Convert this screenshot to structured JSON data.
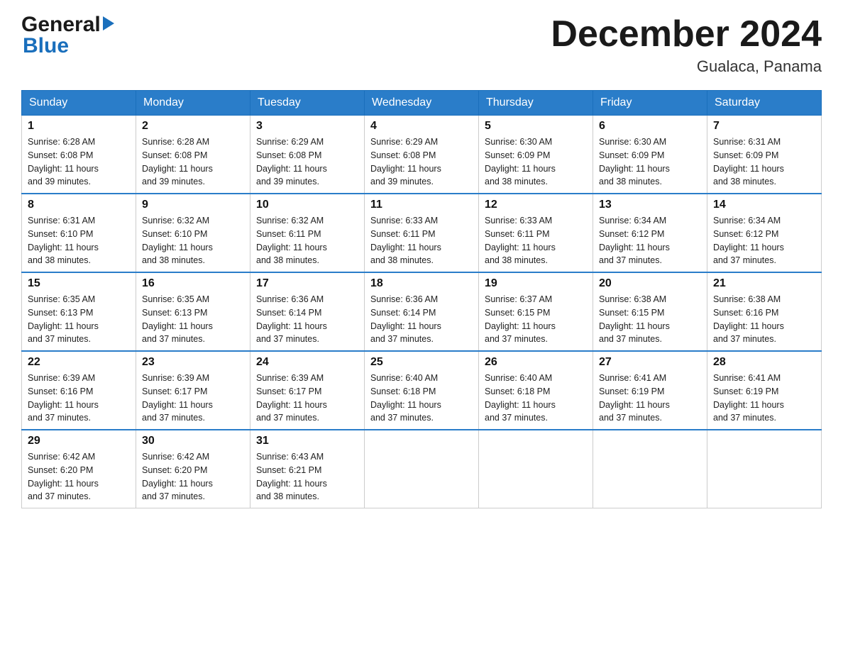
{
  "header": {
    "logo_general": "General",
    "logo_blue": "Blue",
    "month_title": "December 2024",
    "location": "Gualaca, Panama"
  },
  "weekdays": [
    "Sunday",
    "Monday",
    "Tuesday",
    "Wednesday",
    "Thursday",
    "Friday",
    "Saturday"
  ],
  "weeks": [
    [
      {
        "day": "1",
        "sunrise": "6:28 AM",
        "sunset": "6:08 PM",
        "daylight": "11 hours and 39 minutes."
      },
      {
        "day": "2",
        "sunrise": "6:28 AM",
        "sunset": "6:08 PM",
        "daylight": "11 hours and 39 minutes."
      },
      {
        "day": "3",
        "sunrise": "6:29 AM",
        "sunset": "6:08 PM",
        "daylight": "11 hours and 39 minutes."
      },
      {
        "day": "4",
        "sunrise": "6:29 AM",
        "sunset": "6:08 PM",
        "daylight": "11 hours and 39 minutes."
      },
      {
        "day": "5",
        "sunrise": "6:30 AM",
        "sunset": "6:09 PM",
        "daylight": "11 hours and 38 minutes."
      },
      {
        "day": "6",
        "sunrise": "6:30 AM",
        "sunset": "6:09 PM",
        "daylight": "11 hours and 38 minutes."
      },
      {
        "day": "7",
        "sunrise": "6:31 AM",
        "sunset": "6:09 PM",
        "daylight": "11 hours and 38 minutes."
      }
    ],
    [
      {
        "day": "8",
        "sunrise": "6:31 AM",
        "sunset": "6:10 PM",
        "daylight": "11 hours and 38 minutes."
      },
      {
        "day": "9",
        "sunrise": "6:32 AM",
        "sunset": "6:10 PM",
        "daylight": "11 hours and 38 minutes."
      },
      {
        "day": "10",
        "sunrise": "6:32 AM",
        "sunset": "6:11 PM",
        "daylight": "11 hours and 38 minutes."
      },
      {
        "day": "11",
        "sunrise": "6:33 AM",
        "sunset": "6:11 PM",
        "daylight": "11 hours and 38 minutes."
      },
      {
        "day": "12",
        "sunrise": "6:33 AM",
        "sunset": "6:11 PM",
        "daylight": "11 hours and 38 minutes."
      },
      {
        "day": "13",
        "sunrise": "6:34 AM",
        "sunset": "6:12 PM",
        "daylight": "11 hours and 37 minutes."
      },
      {
        "day": "14",
        "sunrise": "6:34 AM",
        "sunset": "6:12 PM",
        "daylight": "11 hours and 37 minutes."
      }
    ],
    [
      {
        "day": "15",
        "sunrise": "6:35 AM",
        "sunset": "6:13 PM",
        "daylight": "11 hours and 37 minutes."
      },
      {
        "day": "16",
        "sunrise": "6:35 AM",
        "sunset": "6:13 PM",
        "daylight": "11 hours and 37 minutes."
      },
      {
        "day": "17",
        "sunrise": "6:36 AM",
        "sunset": "6:14 PM",
        "daylight": "11 hours and 37 minutes."
      },
      {
        "day": "18",
        "sunrise": "6:36 AM",
        "sunset": "6:14 PM",
        "daylight": "11 hours and 37 minutes."
      },
      {
        "day": "19",
        "sunrise": "6:37 AM",
        "sunset": "6:15 PM",
        "daylight": "11 hours and 37 minutes."
      },
      {
        "day": "20",
        "sunrise": "6:38 AM",
        "sunset": "6:15 PM",
        "daylight": "11 hours and 37 minutes."
      },
      {
        "day": "21",
        "sunrise": "6:38 AM",
        "sunset": "6:16 PM",
        "daylight": "11 hours and 37 minutes."
      }
    ],
    [
      {
        "day": "22",
        "sunrise": "6:39 AM",
        "sunset": "6:16 PM",
        "daylight": "11 hours and 37 minutes."
      },
      {
        "day": "23",
        "sunrise": "6:39 AM",
        "sunset": "6:17 PM",
        "daylight": "11 hours and 37 minutes."
      },
      {
        "day": "24",
        "sunrise": "6:39 AM",
        "sunset": "6:17 PM",
        "daylight": "11 hours and 37 minutes."
      },
      {
        "day": "25",
        "sunrise": "6:40 AM",
        "sunset": "6:18 PM",
        "daylight": "11 hours and 37 minutes."
      },
      {
        "day": "26",
        "sunrise": "6:40 AM",
        "sunset": "6:18 PM",
        "daylight": "11 hours and 37 minutes."
      },
      {
        "day": "27",
        "sunrise": "6:41 AM",
        "sunset": "6:19 PM",
        "daylight": "11 hours and 37 minutes."
      },
      {
        "day": "28",
        "sunrise": "6:41 AM",
        "sunset": "6:19 PM",
        "daylight": "11 hours and 37 minutes."
      }
    ],
    [
      {
        "day": "29",
        "sunrise": "6:42 AM",
        "sunset": "6:20 PM",
        "daylight": "11 hours and 37 minutes."
      },
      {
        "day": "30",
        "sunrise": "6:42 AM",
        "sunset": "6:20 PM",
        "daylight": "11 hours and 37 minutes."
      },
      {
        "day": "31",
        "sunrise": "6:43 AM",
        "sunset": "6:21 PM",
        "daylight": "11 hours and 38 minutes."
      },
      null,
      null,
      null,
      null
    ]
  ],
  "labels": {
    "sunrise": "Sunrise:",
    "sunset": "Sunset:",
    "daylight": "Daylight:"
  }
}
